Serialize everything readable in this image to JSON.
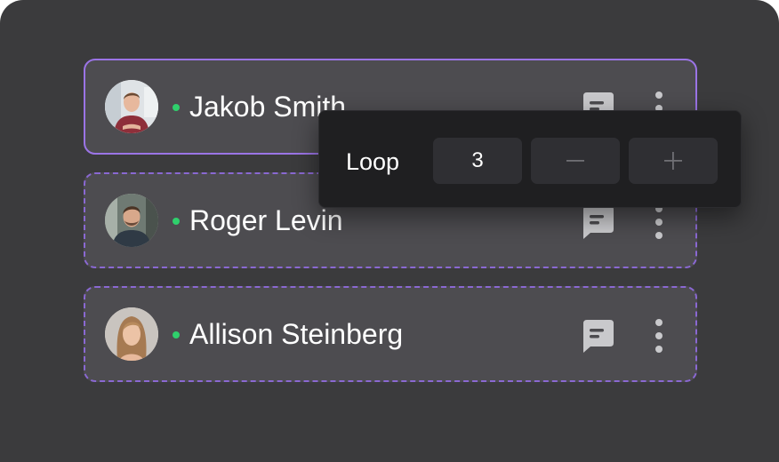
{
  "users": [
    {
      "name": "Jakob Smith",
      "status": "online",
      "status_color": "#2fd06c"
    },
    {
      "name": "Roger Levin",
      "status": "online",
      "status_color": "#2fd06c"
    },
    {
      "name": "Allison Steinberg",
      "status": "online",
      "status_color": "#2fd06c"
    }
  ],
  "icons": {
    "message": "chat-bubble-icon",
    "more": "more-vertical-icon",
    "decrement": "minus-icon",
    "increment": "plus-icon"
  },
  "loop_popover": {
    "label": "Loop",
    "value": "3"
  },
  "colors": {
    "background": "#3b3b3d",
    "card": "#4d4c50",
    "accent": "#9b74e6",
    "popover": "#1f1f21",
    "control": "#2f2f33",
    "icon": "#c9c9cc"
  }
}
